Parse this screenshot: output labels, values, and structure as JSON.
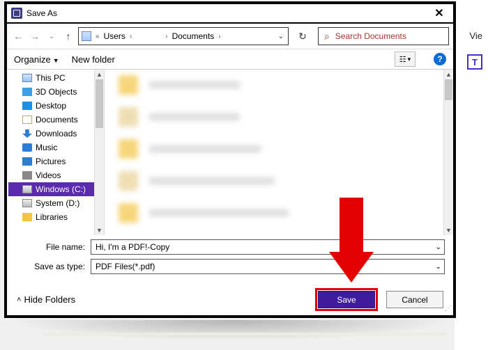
{
  "host": {
    "vie": "Vie",
    "t": "T"
  },
  "dialog": {
    "title": "Save As",
    "nav": {
      "breadcrumb": {
        "sep0": "«",
        "seg1": "Users",
        "sep": "›",
        "seg2": "",
        "seg3": "Documents"
      },
      "search_placeholder": "Search Documents"
    },
    "toolbar": {
      "organize": "Organize",
      "newfolder": "New folder"
    },
    "tree": {
      "items": [
        {
          "label": "This PC",
          "icon": "pc"
        },
        {
          "label": "3D Objects",
          "icon": "obj"
        },
        {
          "label": "Desktop",
          "icon": "desk"
        },
        {
          "label": "Documents",
          "icon": "doc"
        },
        {
          "label": "Downloads",
          "icon": "down"
        },
        {
          "label": "Music",
          "icon": "mus"
        },
        {
          "label": "Pictures",
          "icon": "picf"
        },
        {
          "label": "Videos",
          "icon": "vid"
        },
        {
          "label": "Windows (C:)",
          "icon": "drv",
          "selected": true
        },
        {
          "label": "System (D:)",
          "icon": "drv"
        },
        {
          "label": "Libraries",
          "icon": "fol"
        }
      ]
    },
    "form": {
      "filename_label": "File name:",
      "filename_value": "Hi, I'm a PDF!-Copy",
      "type_label": "Save as type:",
      "type_value": "PDF Files(*.pdf)"
    },
    "footer": {
      "hide": "Hide Folders",
      "save": "Save",
      "cancel": "Cancel"
    }
  }
}
